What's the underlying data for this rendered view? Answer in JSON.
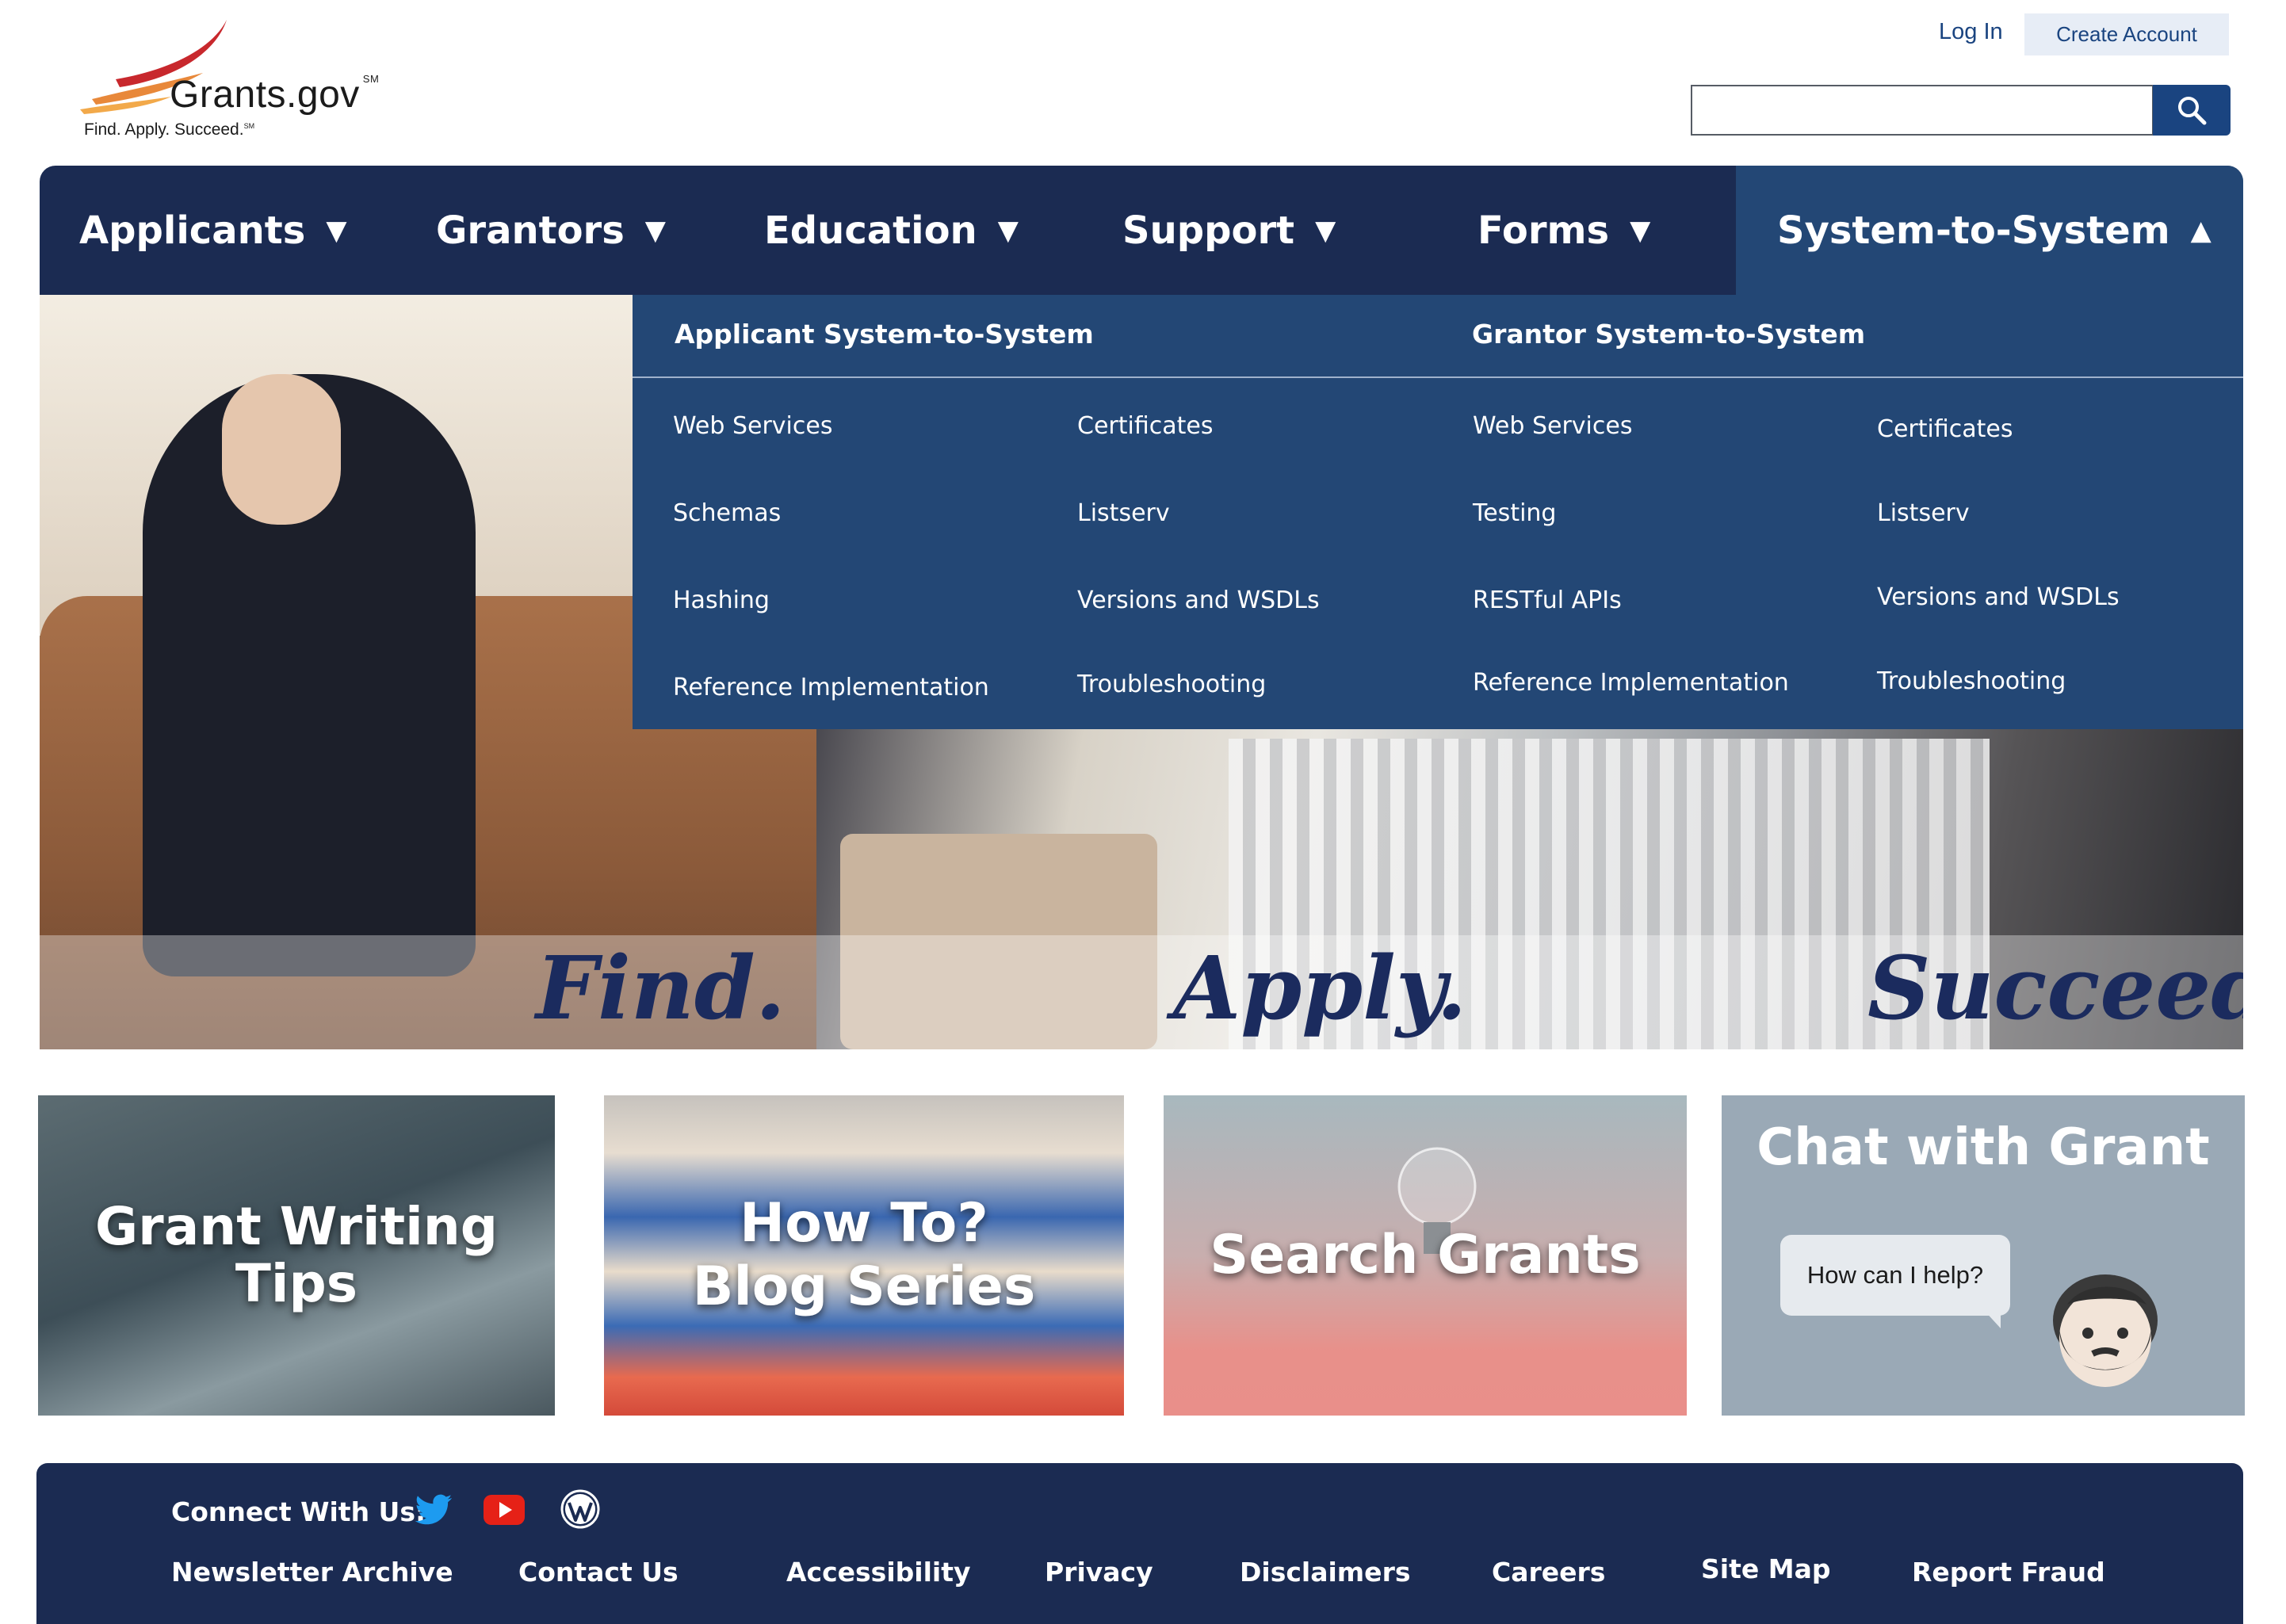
{
  "header": {
    "logo_text": "Grants.gov",
    "logo_sm": "SM",
    "tagline": "Find. Apply. Succeed.",
    "tagline_sm": "SM",
    "login_label": "Log In",
    "create_account_label": "Create Account",
    "search_value": ""
  },
  "nav": {
    "items": [
      {
        "label": "Applicants",
        "caret": "▼"
      },
      {
        "label": "Grantors",
        "caret": "▼"
      },
      {
        "label": "Education",
        "caret": "▼"
      },
      {
        "label": "Support",
        "caret": "▼"
      },
      {
        "label": "Forms",
        "caret": "▼"
      },
      {
        "label": "System-to-System",
        "caret": "▲"
      }
    ]
  },
  "mega_menu": {
    "applicant_heading": "Applicant System-to-System",
    "grantor_heading": "Grantor System-to-System",
    "applicant_col1": [
      "Web Services",
      "Schemas",
      "Hashing",
      "Reference Implementation"
    ],
    "applicant_col2": [
      "Certificates",
      "Listserv",
      "Versions and WSDLs",
      "Troubleshooting"
    ],
    "grantor_col1": [
      "Web Services",
      "Testing",
      "RESTful APIs",
      "Reference Implementation"
    ],
    "grantor_col2": [
      "Certificates",
      "Listserv",
      "Versions and WSDLs",
      "Troubleshooting"
    ]
  },
  "hero": {
    "word1": "Find.",
    "word2": "Apply.",
    "word3": "Succeed."
  },
  "cards": {
    "grant_writing_line1": "Grant Writing",
    "grant_writing_line2": "Tips",
    "howto_line1": "How To?",
    "howto_line2": "Blog Series",
    "search_grants": "Search Grants",
    "chat_title": "Chat with Grant",
    "chat_bubble": "How can I help?"
  },
  "footer": {
    "connect_label": "Connect With Us:",
    "links": [
      "Newsletter Archive",
      "Contact Us",
      "Accessibility",
      "Privacy",
      "Disclaimers",
      "Careers",
      "Site Map",
      "Report Fraud"
    ]
  },
  "colors": {
    "nav_bg": "#1b2b52",
    "active_bg": "#234775",
    "link_blue": "#1a4480",
    "twitter": "#1d9bf0",
    "youtube": "#e62117"
  },
  "icons": [
    "search-icon",
    "twitter-icon",
    "youtube-icon",
    "wordpress-icon",
    "avatar-icon"
  ]
}
